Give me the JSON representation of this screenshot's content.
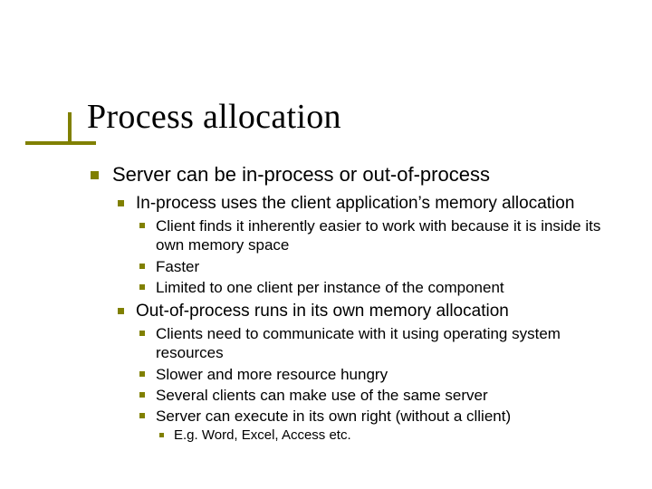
{
  "title": "Process allocation",
  "l1": {
    "text": "Server can be in-process or out-of-process",
    "children": [
      {
        "text": "In-process uses the client application’s memory allocation",
        "children": [
          {
            "text": "Client finds it inherently easier to work with because it is inside its own memory space"
          },
          {
            "text": "Faster"
          },
          {
            "text": "Limited to one client per instance of the component"
          }
        ]
      },
      {
        "text": "Out-of-process runs in its own memory allocation",
        "children": [
          {
            "text": "Clients need to communicate with it using operating system resources"
          },
          {
            "text": "Slower and more resource hungry"
          },
          {
            "text": "Several clients can make use of the same server"
          },
          {
            "text": "Server can execute in its own right (without a cllient)",
            "children": [
              {
                "text": "E.g. Word, Excel, Access etc."
              }
            ]
          }
        ]
      }
    ]
  }
}
